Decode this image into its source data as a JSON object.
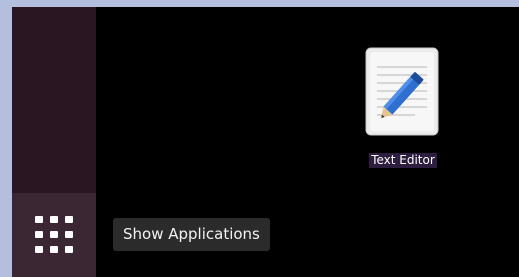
{
  "desktop": {
    "icons": [
      {
        "label": "Text Editor",
        "icon": "text-editor-icon"
      }
    ]
  },
  "dock": {
    "show_apps_icon": "grid-icon",
    "tooltip": "Show Applications"
  },
  "colors": {
    "frame": "#b3bfdc",
    "desktop_bg": "#000000",
    "dock_bg": "#2a1523",
    "dock_button_active": "#3a2733",
    "tooltip_bg": "#2b2b2b",
    "label_bg": "#2d1d3f"
  }
}
